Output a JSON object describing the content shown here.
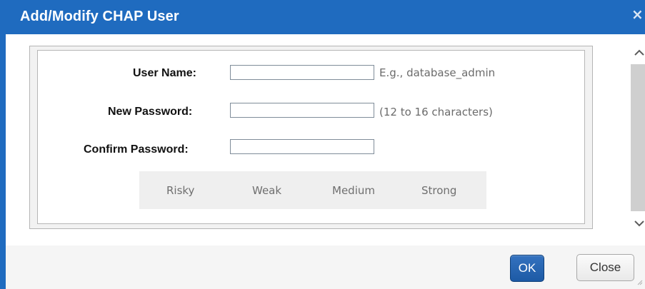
{
  "dialog": {
    "title": "Add/Modify CHAP User",
    "close_icon_glyph": "×"
  },
  "form": {
    "user_name_label": "User Name:",
    "new_password_label": "New Password:",
    "confirm_password_label": "Confirm Password:",
    "user_name_value": "",
    "new_password_value": "",
    "confirm_password_value": "",
    "user_name_hint": "E.g., database_admin",
    "password_hint": "(12 to 16 characters)"
  },
  "strength": {
    "labels": [
      "Risky",
      "Weak",
      "Medium",
      "Strong"
    ]
  },
  "buttons": {
    "ok_label": "OK",
    "close_label": "Close"
  },
  "icons": {
    "close": "close-icon",
    "scroll_up": "chevron-up-icon",
    "scroll_down": "chevron-down-icon",
    "resize": "resize-grip-icon"
  },
  "colors": {
    "titlebar": "#1f6bbf",
    "ok_button": "#1d5aa5",
    "hint_text": "#6b6b6b",
    "strength_background": "#efefef"
  }
}
